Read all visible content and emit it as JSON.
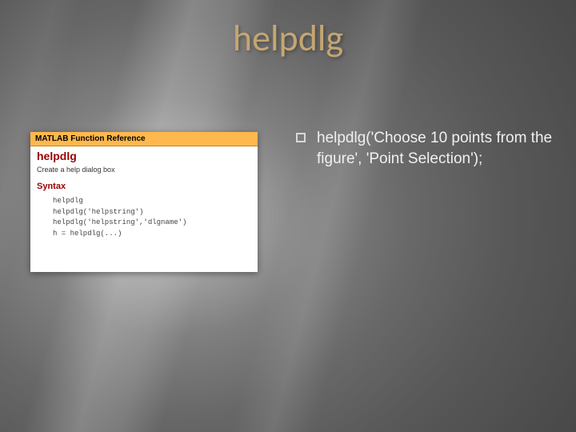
{
  "title": "helpdlg",
  "doc": {
    "header": "MATLAB Function Reference",
    "fn_name": "helpdlg",
    "desc": "Create a help dialog box",
    "section": "Syntax",
    "syntax": [
      "helpdlg",
      "helpdlg('helpstring')",
      "helpdlg('helpstring','dlgname')",
      "h = helpdlg(...)"
    ]
  },
  "bullet": {
    "text": "helpdlg('Choose 10 points from the figure', 'Point Selection');"
  }
}
